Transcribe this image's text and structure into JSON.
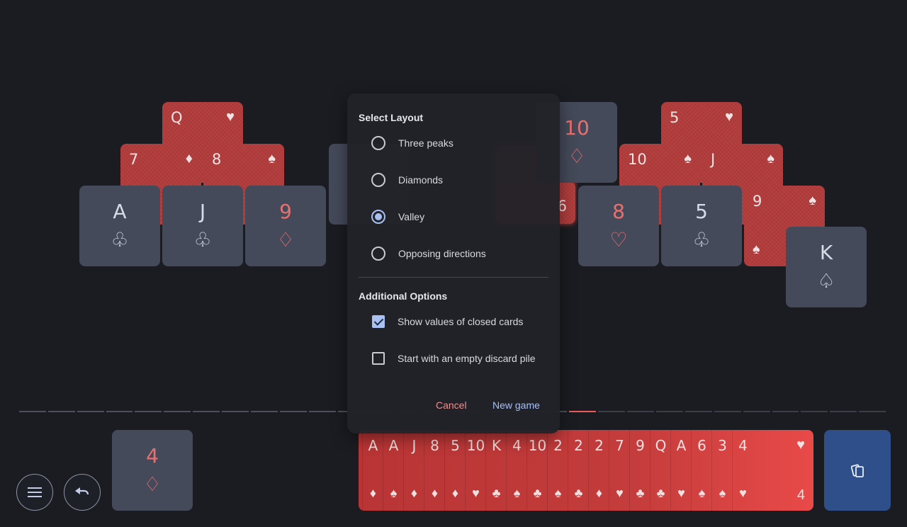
{
  "colors": {
    "background": "#1b1c21",
    "open_card": "#454a5a",
    "closed_card": "#b63f3f",
    "black_suit": "#d7dbe6",
    "red_suit": "#ea6f6f",
    "accent": "#a8c0f2",
    "cancel": "#ef8e8e",
    "draw_pile": "#2f4f8a"
  },
  "tableau": {
    "left_peak": {
      "top": {
        "rank": "Q",
        "suit": "♥"
      },
      "middle": [
        {
          "rank": "7",
          "suit": "♦"
        },
        {
          "rank": "8",
          "suit": "♠"
        }
      ],
      "bottom": [
        {
          "rank": "A",
          "suit": "♧"
        },
        {
          "rank": "J",
          "suit": "♧"
        },
        {
          "rank": "9",
          "suit": "♢"
        }
      ]
    },
    "center_peak": {
      "top": {
        "rank": "10",
        "suit": "♢"
      },
      "edge": "6"
    },
    "right_peak": {
      "top": {
        "rank": "5",
        "suit": "♥"
      },
      "middle": [
        {
          "rank": "10",
          "suit": "♠"
        },
        {
          "rank": "J",
          "suit": "♠"
        }
      ],
      "bottom": [
        {
          "rank": "8",
          "suit": "♡"
        },
        {
          "rank": "5",
          "suit": "♧"
        },
        {
          "rank": "9",
          "suit": "♠"
        }
      ],
      "extra": {
        "rank": "K",
        "suit": "♤"
      }
    }
  },
  "waste": {
    "rank": "4",
    "suit": "♢"
  },
  "stock": {
    "ranks": [
      "A",
      "A",
      "J",
      "8",
      "5",
      "10",
      "K",
      "4",
      "10",
      "2",
      "2",
      "2",
      "7",
      "9",
      "Q",
      "A",
      "6",
      "3",
      "4"
    ],
    "suits": [
      "♦",
      "♠",
      "♦",
      "♦",
      "♦",
      "♥",
      "♣",
      "♠",
      "♣",
      "♠",
      "♣",
      "♦",
      "♥",
      "♣",
      "♣",
      "♥",
      "♠",
      "♠",
      "♥"
    ],
    "top_suit": "♥",
    "count": "4"
  },
  "progress": {
    "segments": 30,
    "done": 19,
    "current_index": 19
  },
  "dialog": {
    "layout_heading": "Select Layout",
    "layouts": [
      {
        "label": "Three peaks",
        "selected": false
      },
      {
        "label": "Diamonds",
        "selected": false
      },
      {
        "label": "Valley",
        "selected": true
      },
      {
        "label": "Opposing directions",
        "selected": false
      }
    ],
    "options_heading": "Additional Options",
    "options": [
      {
        "label": "Show values of closed cards",
        "checked": true
      },
      {
        "label": "Start with an empty discard pile",
        "checked": false
      }
    ],
    "cancel_label": "Cancel",
    "new_game_label": "New game"
  },
  "buttons": {
    "menu_icon": "menu-icon",
    "undo_icon": "undo-icon"
  }
}
